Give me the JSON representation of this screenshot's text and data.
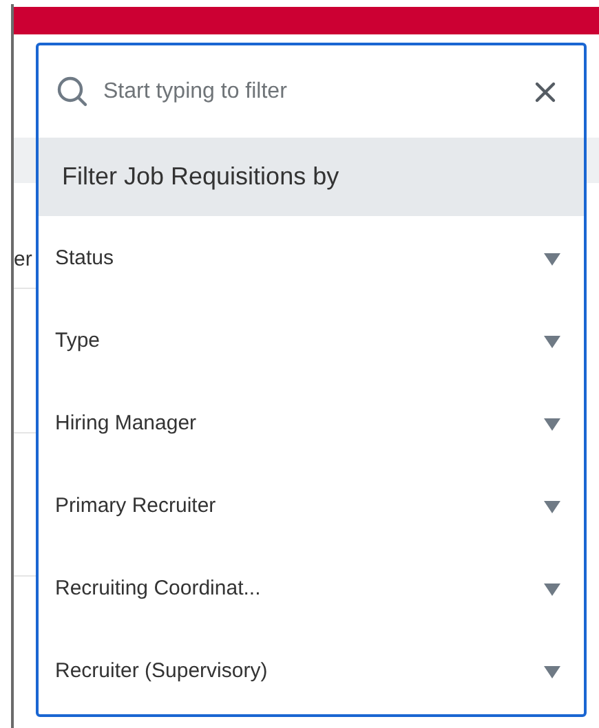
{
  "background": {
    "partial_label": "er"
  },
  "filter_popup": {
    "search": {
      "placeholder": "Start typing to filter"
    },
    "heading": "Filter Job Requisitions by",
    "items": [
      {
        "label": "Status",
        "expanded": false
      },
      {
        "label": "Type",
        "expanded": false
      },
      {
        "label": "Hiring Manager",
        "expanded": false
      },
      {
        "label": "Primary Recruiter",
        "expanded": false
      },
      {
        "label": "Recruiting Coordinat...",
        "expanded": false
      },
      {
        "label": "Recruiter (Supervisory)",
        "expanded": false
      }
    ]
  }
}
